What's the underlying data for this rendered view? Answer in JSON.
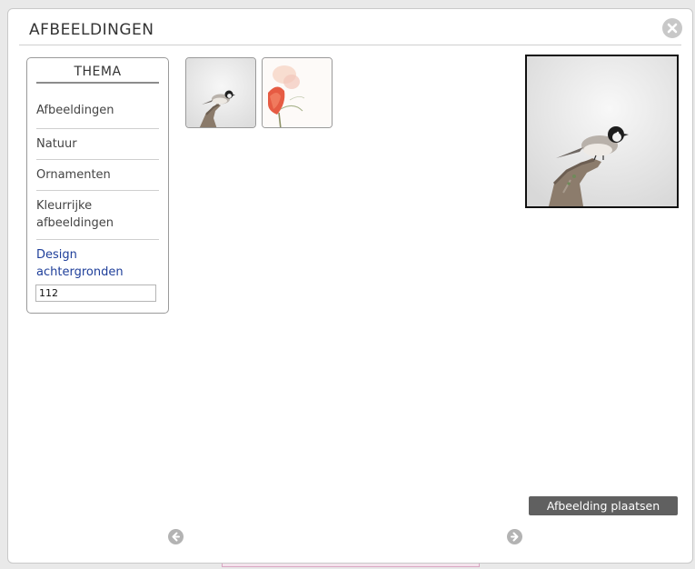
{
  "dialog": {
    "title": "AFBEELDINGEN",
    "close_icon": "close-circle-icon"
  },
  "thema": {
    "heading": "THEMA",
    "items": [
      {
        "label": "Afbeeldingen",
        "active": false
      },
      {
        "label": "Natuur",
        "active": false
      },
      {
        "label": "Ornamenten",
        "active": false
      },
      {
        "label": "Kleurrijke afbeeldingen",
        "active": false
      },
      {
        "label": "Design achtergronden",
        "active": true
      }
    ],
    "search_value": "112"
  },
  "thumbnails": [
    {
      "subject": "chickadee-on-branch",
      "selected": true
    },
    {
      "subject": "rose-watercolor",
      "selected": false
    }
  ],
  "preview": {
    "subject": "chickadee-on-branch"
  },
  "actions": {
    "place_label": "Afbeelding plaatsen",
    "prev_icon": "arrow-left-circle-icon",
    "next_icon": "arrow-right-circle-icon"
  },
  "colors": {
    "active_item": "#1f3f9a",
    "button_bg": "#606060",
    "icon_grey": "#b3b3b3"
  }
}
